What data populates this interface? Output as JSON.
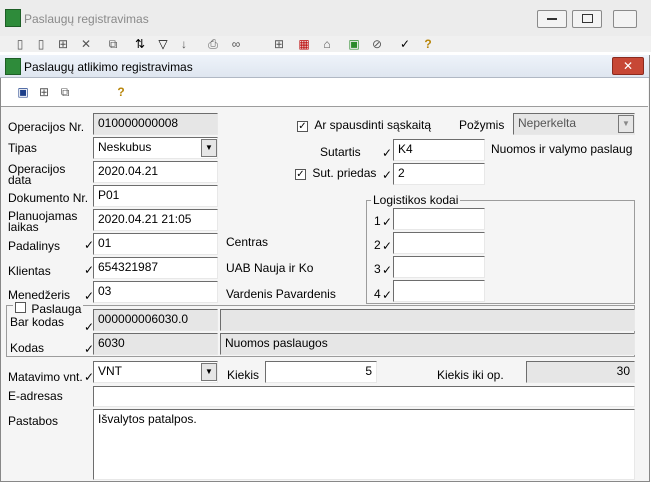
{
  "background_window": {
    "title": "Paslaugų registravimas",
    "toolbar_icons": [
      "new-doc-icon",
      "doc-icon",
      "tree-icon",
      "delete-icon",
      "copy-icon",
      "sort-icon",
      "filter-icon",
      "sort-az-icon",
      "print-icon",
      "binoculars-icon",
      "tree2-icon",
      "calendar-icon",
      "house-icon",
      "export-icon",
      "attach-icon",
      "check-icon",
      "help-icon"
    ]
  },
  "dialog": {
    "title": "Paslaugų atlikimo registravimas",
    "close_glyph": "✕",
    "toolbar_icons": [
      "save-icon",
      "tree-icon",
      "copy-icon",
      "help-icon"
    ]
  },
  "form": {
    "operacijos_nr": {
      "label": "Operacijos Nr.",
      "value": "010000000008"
    },
    "tipas": {
      "label": "Tipas",
      "value": "Neskubus"
    },
    "operacijos_data": {
      "label_line1": "Operacijos",
      "label_line2": "data",
      "value": "2020.04.21"
    },
    "dokumento_nr": {
      "label": "Dokumento Nr.",
      "value": "P01"
    },
    "planuojamas_laikas": {
      "label_line1": "Planuojamas",
      "label_line2": "laikas",
      "value": "2020.04.21 21:05"
    },
    "padalinys": {
      "label": "Padalinys",
      "value": "01",
      "name": "Centras"
    },
    "klientas": {
      "label": "Klientas",
      "value": "654321987",
      "name": "UAB Nauja ir Ko"
    },
    "menedzeris": {
      "label": "Menedžeris",
      "value": "03",
      "name": "Vardenis Pavardenis"
    },
    "spausdinti": {
      "label": "Ar spausdinti sąskaitą",
      "checked": true
    },
    "pozymis": {
      "label": "Požymis",
      "value": "Neperkelta"
    },
    "sutartis": {
      "label": "Sutartis",
      "value": "K4",
      "name": "Nuomos ir valymo paslaug"
    },
    "sut_priedas": {
      "label": "Sut. priedas",
      "value": "2",
      "checked": true
    },
    "logistikos": {
      "title": "Logistikos kodai",
      "rows": [
        {
          "num": "1"
        },
        {
          "num": "2"
        },
        {
          "num": "3"
        },
        {
          "num": "4"
        }
      ]
    },
    "paslauga": {
      "label": "Paslauga",
      "checked": false
    },
    "bar_kodas": {
      "label": "Bar kodas",
      "value": "000000006030.0"
    },
    "kodas": {
      "label": "Kodas",
      "value": "6030",
      "name": "Nuomos paslaugos"
    },
    "matavimo": {
      "label": "Matavimo vnt.",
      "value": "VNT"
    },
    "kiekis": {
      "label": "Kiekis",
      "value": "5"
    },
    "kiekis_iki": {
      "label": "Kiekis iki op.",
      "value": "30"
    },
    "e_adresas": {
      "label": "E-adresas",
      "value": ""
    },
    "pastabos": {
      "label": "Pastabos",
      "value": "Išvalytos patalpos."
    },
    "checkmark_glyph": "✓",
    "dropdown_glyph": "▼"
  }
}
